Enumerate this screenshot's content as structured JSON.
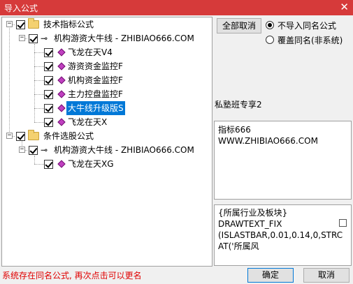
{
  "window": {
    "title": "导入公式",
    "close_glyph": "✕"
  },
  "tree": {
    "root1": {
      "label": "技术指标公式",
      "expander": "−"
    },
    "group1": {
      "label": "机构游资大牛线 - ZHIBIAO666.COM",
      "expander": "−"
    },
    "items1": [
      {
        "label": "飞龙在天V4"
      },
      {
        "label": "游资资金监控F"
      },
      {
        "label": "机构资金监控F"
      },
      {
        "label": "主力控盘监控F"
      },
      {
        "label": "大牛线升级版S"
      },
      {
        "label": "飞龙在天X"
      }
    ],
    "root2": {
      "label": "条件选股公式",
      "expander": "−"
    },
    "group2": {
      "label": "机构游资大牛线 - ZHIBIAO666.COM",
      "expander": "−"
    },
    "items2": [
      {
        "label": "飞龙在天XG"
      }
    ]
  },
  "controls": {
    "cancel_all": "全部取消",
    "radio_no_import": "不导入同名公式",
    "radio_overwrite": "覆盖同名(非系统)"
  },
  "info": {
    "author": "私塾班专享2",
    "description_line1": "指标666",
    "description_line2": "WWW.ZHIBIAO666.COM",
    "code_line1": "{所属行业及板块}",
    "code_line2": "DRAWTEXT_FIX",
    "code_line3": "(ISLASTBAR,0.01,0.14,0,STRC",
    "code_line4": "AT('所属风"
  },
  "status_text": "系统存在同名公式, 再次点击可以更名",
  "buttons": {
    "ok": "确定",
    "cancel": "取消"
  }
}
